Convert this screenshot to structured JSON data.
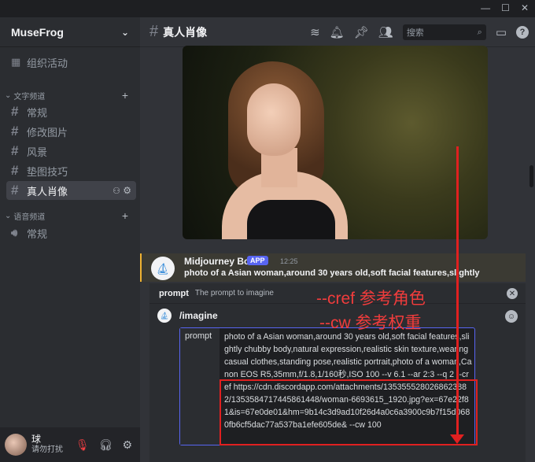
{
  "window": {
    "controls": [
      "—",
      "☐",
      "✕"
    ]
  },
  "server": {
    "name": "MuseFrog"
  },
  "sidebar": {
    "events_label": "组织活动",
    "text_category": "文字频道",
    "channels": [
      "常规",
      "修改图片",
      "风景",
      "垫图技巧",
      "真人肖像"
    ],
    "voice_category": "语音频道",
    "voice_channel": "常规"
  },
  "user": {
    "name": "球",
    "status": "请勿打扰"
  },
  "header": {
    "channel": "真人肖像",
    "search_placeholder": "搜索"
  },
  "message": {
    "author": "Midjourney Bot",
    "badge": "APP",
    "time": "12:25",
    "text": "photo of a Asian woman,around 30 years old,soft facial features,slightly"
  },
  "prompt_panel": {
    "name": "prompt",
    "description": "The prompt to imagine",
    "command": "/imagine",
    "option_label": "prompt",
    "value": "photo of a Asian woman,around 30 years old,soft facial features,slightly chubby body,natural expression,realistic skin texture,wearing casual clothes,standing pose,realistic portrait,photo of a woman,Canon EOS R5,35mm,f/1.8,1/160秒,ISO 100 --v 6.1 --ar 2:3 --q 2 --cref https://cdn.discordapp.com/attachments/1353555280268623882/1353584717445861448/woman-6693615_1920.jpg?ex=67e22f81&is=67e0de01&hm=9b14c3d9ad10f26d4a0c6a3900c9b7f15d0680fb6cf5dac77a537ba1efe605de& --cw 100"
  },
  "annotations": {
    "cref": "--cref 参考角色",
    "cw": "--cw 参考权重",
    "color": "#e02020"
  }
}
